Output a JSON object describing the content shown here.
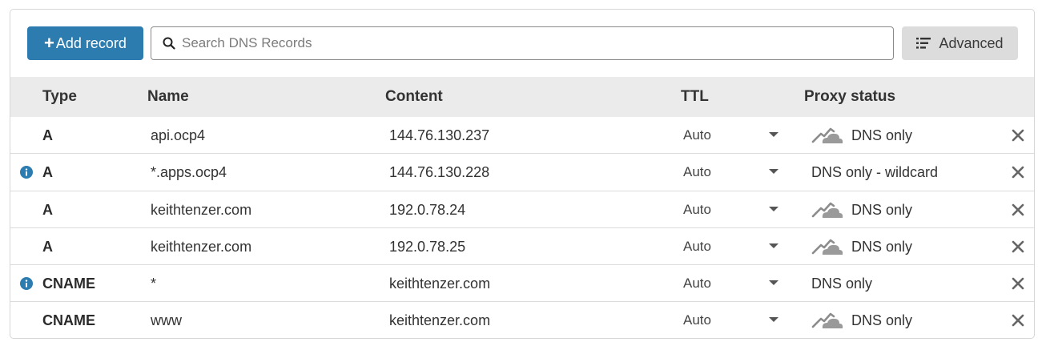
{
  "toolbar": {
    "add_label": "Add record",
    "search_placeholder": "Search DNS Records",
    "advanced_label": "Advanced"
  },
  "table": {
    "columns": {
      "type": "Type",
      "name": "Name",
      "content": "Content",
      "ttl": "TTL",
      "proxy": "Proxy status"
    },
    "rows": [
      {
        "info": false,
        "type": "A",
        "name": "api.ocp4",
        "content": "144.76.130.237",
        "ttl": "Auto",
        "proxy_icon": "cloud-dns-only-icon",
        "proxy": "DNS only"
      },
      {
        "info": true,
        "type": "A",
        "name": "*.apps.ocp4",
        "content": "144.76.130.228",
        "ttl": "Auto",
        "proxy_icon": "",
        "proxy": "DNS only - wildcard"
      },
      {
        "info": false,
        "type": "A",
        "name": "keithtenzer.com",
        "content": "192.0.78.24",
        "ttl": "Auto",
        "proxy_icon": "cloud-dns-only-icon",
        "proxy": "DNS only"
      },
      {
        "info": false,
        "type": "A",
        "name": "keithtenzer.com",
        "content": "192.0.78.25",
        "ttl": "Auto",
        "proxy_icon": "cloud-dns-only-icon",
        "proxy": "DNS only"
      },
      {
        "info": true,
        "type": "CNAME",
        "name": "*",
        "content": "keithtenzer.com",
        "ttl": "Auto",
        "proxy_icon": "",
        "proxy": "DNS only"
      },
      {
        "info": false,
        "type": "CNAME",
        "name": "www",
        "content": "keithtenzer.com",
        "ttl": "Auto",
        "proxy_icon": "cloud-dns-only-icon",
        "proxy": "DNS only"
      }
    ]
  },
  "colors": {
    "accent": "#2c7cb0",
    "header_bg": "#ebebeb",
    "info": "#2c7cb0",
    "cloud": "#9a9a9a"
  }
}
